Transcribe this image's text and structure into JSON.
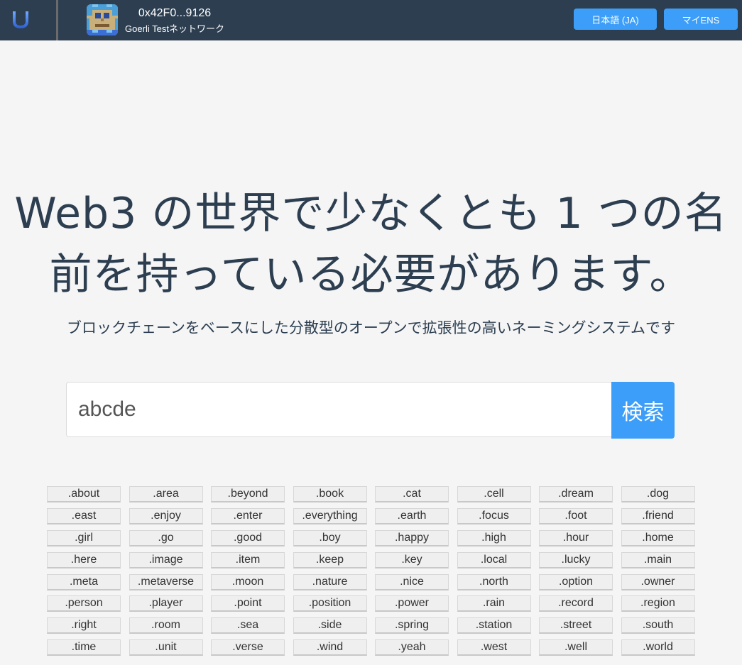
{
  "header": {
    "logo_icon": "u-logo-icon",
    "account_address": "0x42F0...9126",
    "network_name": "Goerli Testネットワーク",
    "avatar_icon": "pixel-avatar-icon",
    "language_button": "日本語 (JA)",
    "my_ens_button": "マイENS"
  },
  "hero": {
    "title_line1": "Web3 の世界で少なくとも 1 つの名",
    "title_line2": "前を持っている必要があります。",
    "subtitle": "ブロックチェーンをベースにした分散型のオープンで拡張性の高いネーミングシステムです"
  },
  "search": {
    "value": "abcde",
    "button_label": "検索"
  },
  "suffixes": [
    ".about",
    ".area",
    ".beyond",
    ".book",
    ".cat",
    ".cell",
    ".dream",
    ".dog",
    ".east",
    ".enjoy",
    ".enter",
    ".everything",
    ".earth",
    ".focus",
    ".foot",
    ".friend",
    ".girl",
    ".go",
    ".good",
    ".boy",
    ".happy",
    ".high",
    ".hour",
    ".home",
    ".here",
    ".image",
    ".item",
    ".keep",
    ".key",
    ".local",
    ".lucky",
    ".main",
    ".meta",
    ".metaverse",
    ".moon",
    ".nature",
    ".nice",
    ".north",
    ".option",
    ".owner",
    ".person",
    ".player",
    ".point",
    ".position",
    ".power",
    ".rain",
    ".record",
    ".region",
    ".right",
    ".room",
    ".sea",
    ".side",
    ".spring",
    ".station",
    ".street",
    ".south",
    ".time",
    ".unit",
    ".verse",
    ".wind",
    ".yeah",
    ".west",
    ".well",
    ".world"
  ],
  "colors": {
    "header_bg": "#2c3e50",
    "accent": "#3c9ef8",
    "page_bg": "#f5f5f5",
    "text": "#2c3e50"
  }
}
